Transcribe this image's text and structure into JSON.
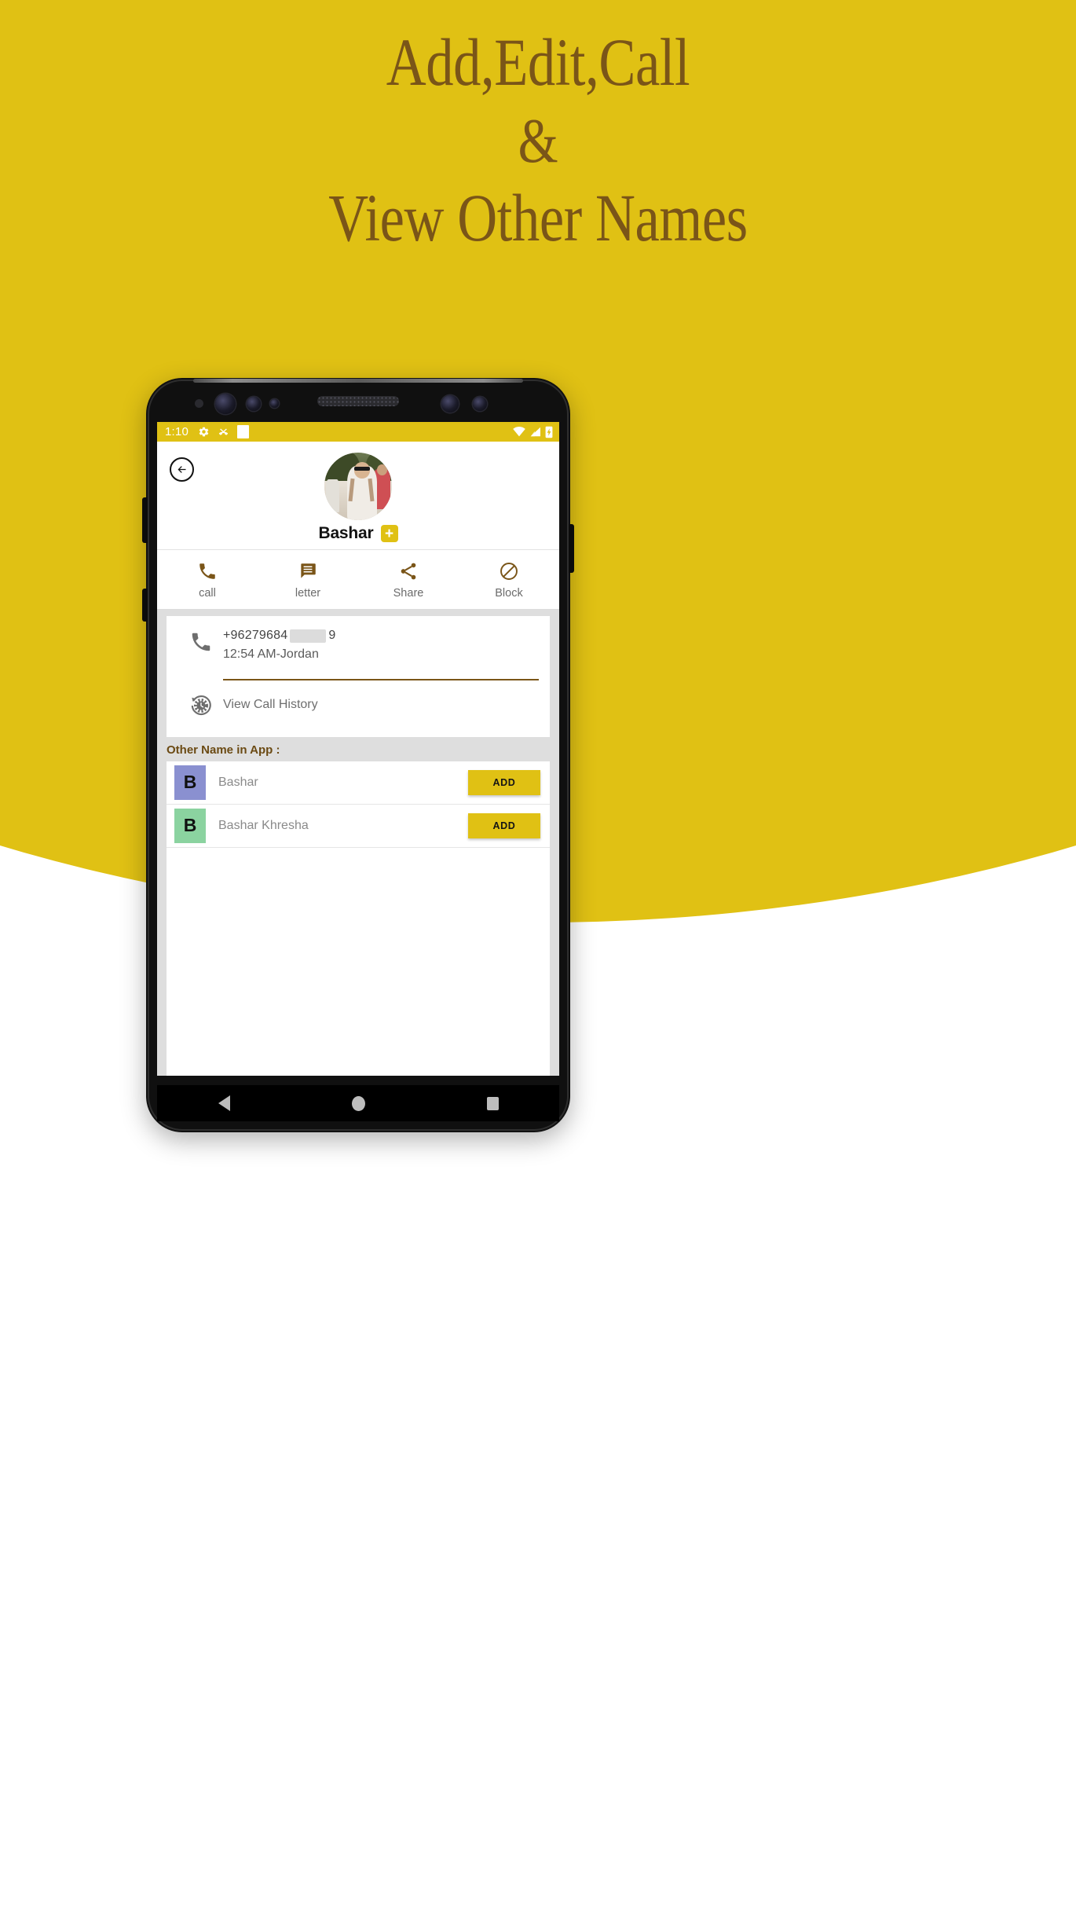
{
  "promo": {
    "headline_line1": "Add,Edit,Call",
    "headline_line2": "&",
    "headline_line3": "View Other Names",
    "bg_color": "#E0C114",
    "headline_color": "#7A5518"
  },
  "statusbar": {
    "time": "1:10",
    "left_icons": [
      "gear-icon",
      "missed-call-icon",
      "white-square-icon"
    ],
    "right_icons": [
      "wifi-icon",
      "signal-icon",
      "battery-charging-icon"
    ]
  },
  "contact": {
    "back_icon": "back-arrow-icon",
    "avatar": "contact-photo",
    "name": "Bashar",
    "add_badge": "+"
  },
  "actions": [
    {
      "label": "call",
      "icon": "phone-icon"
    },
    {
      "label": "letter",
      "icon": "message-icon"
    },
    {
      "label": "Share",
      "icon": "share-icon"
    },
    {
      "label": "Block",
      "icon": "block-icon"
    }
  ],
  "details": {
    "phone_prefix": "+96279684",
    "phone_suffix": "9",
    "phone_redacted": true,
    "phone_sub": "12:54 AM-Jordan",
    "phone_icon": "phone-icon",
    "history_icon": "call-history-icon",
    "history_label": "View Call History",
    "underline_color": "#7A5518"
  },
  "other_names": {
    "section_title": "Other Name in App :",
    "items": [
      {
        "initial": "B",
        "name": "Bashar",
        "avatar_color": "#8a90d0",
        "button_label": "ADD"
      },
      {
        "initial": "B",
        "name": "Bashar Khresha",
        "avatar_color": "#8bd3a0",
        "button_label": "ADD"
      }
    ]
  },
  "navbar": {
    "back": "nav-back-icon",
    "home": "nav-home-icon",
    "recents": "nav-recents-icon"
  }
}
